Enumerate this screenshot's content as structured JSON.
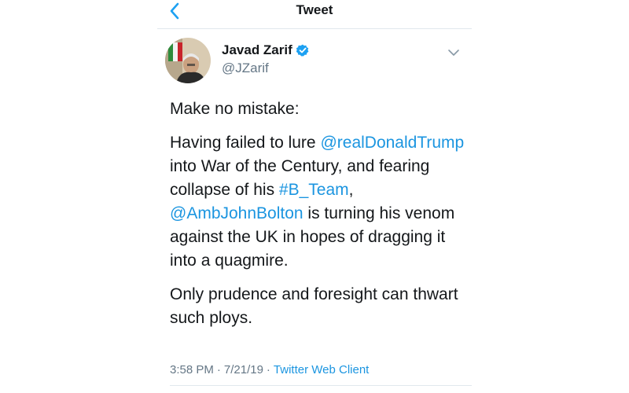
{
  "nav": {
    "title": "Tweet",
    "back_icon": "chevron-left-icon"
  },
  "author": {
    "name": "Javad Zarif",
    "handle": "@JZarif",
    "verified": true,
    "verified_icon": "verified-badge-icon",
    "more_icon": "chevron-down-icon"
  },
  "tweet": {
    "intro": "Make no mistake:",
    "p2": {
      "s1": "Having failed to lure ",
      "mention1": "@realDonaldTrump",
      "s2": " into War of the Century, and fearing collapse of his ",
      "hashtag": "#B_Team",
      "s3": ", ",
      "mention2": "@AmbJohnBolton",
      "s4": " is turning his venom against the UK in hopes of dragging it into a quagmire."
    },
    "p3": "Only prudence and foresight can thwart such ploys."
  },
  "meta": {
    "time": "3:58 PM",
    "separator": "·",
    "date": "7/21/19",
    "sep2": "·",
    "source": "Twitter Web Client"
  },
  "colors": {
    "link": "#1b95e0",
    "muted": "#657786",
    "text": "#14171a"
  }
}
